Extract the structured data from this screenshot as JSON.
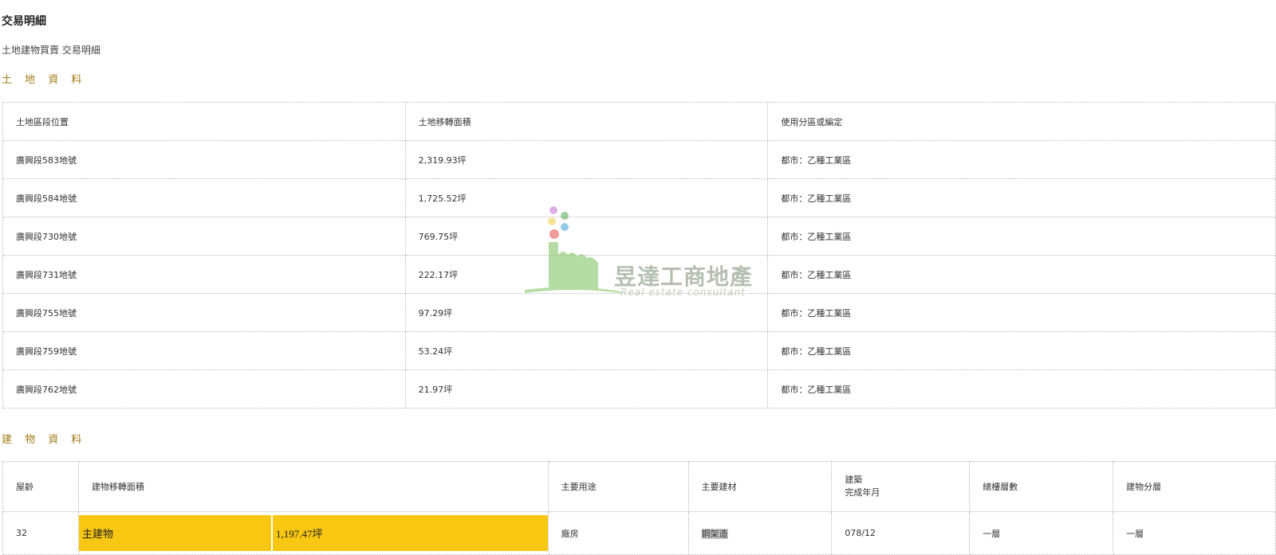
{
  "page_title": "交易明細",
  "subtitle": "土地建物買賣  交易明細",
  "land_section": {
    "title": "土 地 資 料",
    "headers": [
      "土地區段位置",
      "土地移轉面積",
      "使用分區或編定"
    ],
    "rows": [
      [
        "廣興段583地號",
        "2,319.93坪",
        "都市：乙種工業區"
      ],
      [
        "廣興段584地號",
        "1,725.52坪",
        "都市：乙種工業區"
      ],
      [
        "廣興段730地號",
        "769.75坪",
        "都市：乙種工業區"
      ],
      [
        "廣興段731地號",
        "222.17坪",
        "都市：乙種工業區"
      ],
      [
        "廣興段755地號",
        "97.29坪",
        "都市：乙種工業區"
      ],
      [
        "廣興段759地號",
        "53.24坪",
        "都市：乙種工業區"
      ],
      [
        "廣興段762地號",
        "21.97坪",
        "都市：乙種工業區"
      ]
    ]
  },
  "building_section": {
    "title": "建 物 資 料",
    "headers": {
      "age": "屋齡",
      "area": "建物移轉面積",
      "usage": "主要用途",
      "material": "主要建材",
      "built_line1": "建築",
      "built_line2": "完成年月",
      "total_floors": "總樓層數",
      "floor": "建物分層"
    },
    "row": {
      "age": "32",
      "area_label": "主建物",
      "area_value": "1,197.47坪",
      "usage": "廠房",
      "material": "鋼架造",
      "built": "078/12",
      "total_floors": "一層",
      "floor": "一層"
    }
  },
  "watermark": {
    "name": "昱達工商地產",
    "tagline": "Real estate consultant"
  },
  "colors": {
    "section_title": "#a27c1a",
    "highlight": "#f7c712",
    "watermark_green": "#9ccc7a"
  }
}
